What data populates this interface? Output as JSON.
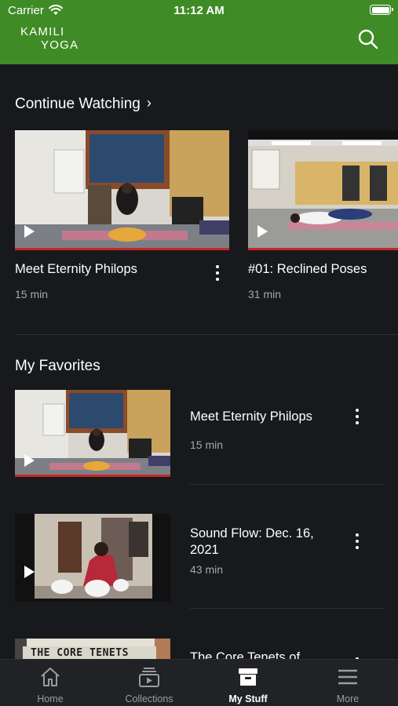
{
  "status_bar": {
    "carrier": "Carrier",
    "time": "11:12 AM"
  },
  "app_bar": {
    "logo_line1": "KAMILI",
    "logo_line2": "YOGA"
  },
  "continue_watching": {
    "title": "Continue Watching",
    "items": [
      {
        "title": "Meet Eternity Philops",
        "duration": "15 min",
        "progress": 1.0
      },
      {
        "title": "#01: Reclined Poses",
        "duration": "31 min",
        "progress": 1.0
      }
    ]
  },
  "favorites": {
    "title": "My Favorites",
    "items": [
      {
        "title": "Meet Eternity Philops",
        "duration": "15 min",
        "progress": 1.0
      },
      {
        "title": "Sound Flow: Dec. 16, 2021",
        "duration": "43 min",
        "progress": 0.0
      },
      {
        "title": "The Core Tenets of",
        "thumb_text": "THE CORE TENETS"
      }
    ]
  },
  "tabs": [
    {
      "label": "Home",
      "icon": "home-icon"
    },
    {
      "label": "Collections",
      "icon": "collections-icon"
    },
    {
      "label": "My Stuff",
      "icon": "my-stuff-icon",
      "active": true
    },
    {
      "label": "More",
      "icon": "menu-icon"
    }
  ],
  "colors": {
    "brand_green": "#3f8b26",
    "background": "#17191c",
    "progress_red": "#c62828",
    "tabbar": "#202225"
  }
}
